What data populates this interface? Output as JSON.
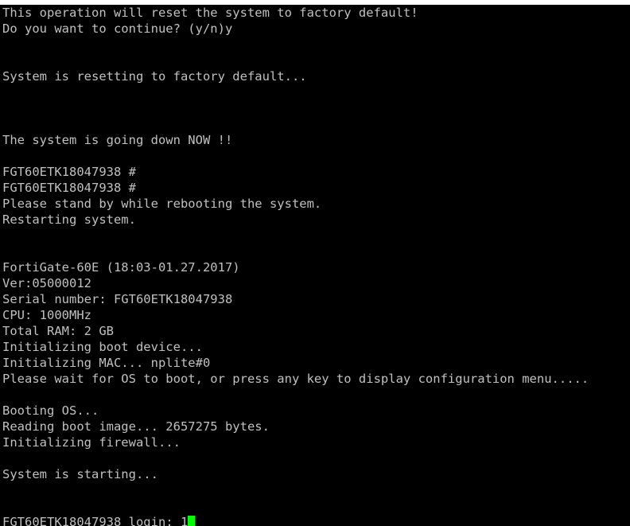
{
  "terminal": {
    "lines": [
      "This operation will reset the system to factory default!",
      "Do you want to continue? (y/n)y",
      "",
      "",
      "System is resetting to factory default...",
      "",
      "",
      "",
      "The system is going down NOW !!",
      "",
      "FGT60ETK18047938 #",
      "FGT60ETK18047938 #",
      "Please stand by while rebooting the system.",
      "Restarting system.",
      "",
      "",
      "FortiGate-60E (18:03-01.27.2017)",
      "Ver:05000012",
      "Serial number: FGT60ETK18047938",
      "CPU: 1000MHz",
      "Total RAM: 2 GB",
      "Initializing boot device...",
      "Initializing MAC... nplite#0",
      "Please wait for OS to boot, or press any key to display configuration menu.....",
      "",
      "Booting OS...",
      "Reading boot image... 2657275 bytes.",
      "Initializing firewall...",
      "",
      "System is starting...",
      "",
      "",
      "FGT60ETK18047938 login: 1"
    ],
    "cursor_color": "#00ff00",
    "text_color": "#c0c0c0",
    "background_color": "#000000"
  }
}
